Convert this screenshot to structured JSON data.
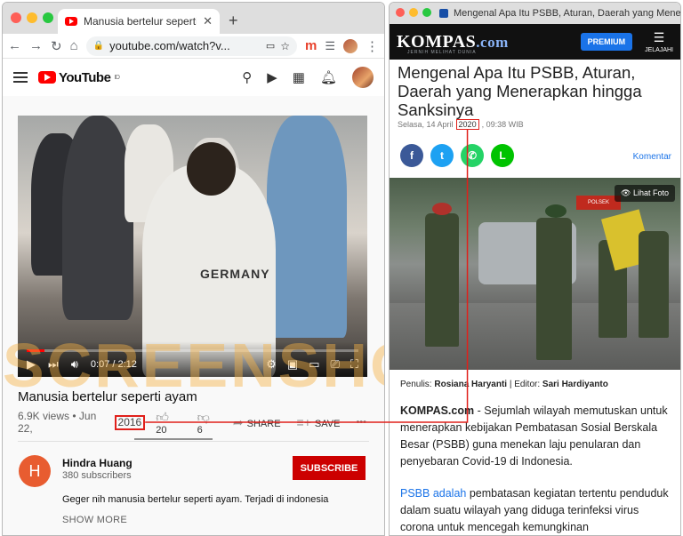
{
  "youtube_window": {
    "tab_title": "Manusia bertelur seperti ayam",
    "tab_close": "✕",
    "new_tab": "+",
    "url": "youtube.com/watch?v...",
    "logo": "YouTube",
    "logo_region": "ID",
    "player": {
      "time": "0:07 / 2:12",
      "progress": 0.053
    },
    "video_title": "Manusia bertelur seperti ayam",
    "views_date": "6.9K views • Jun 22,",
    "year_highlight": "2016",
    "likes": "20",
    "dislikes": "6",
    "share_label": "SHARE",
    "save_label": "SAVE",
    "more": "•••",
    "channel_initial": "H",
    "channel_name": "Hindra Huang",
    "subscribers": "380 subscribers",
    "subscribe_label": "SUBSCRIBE",
    "description": "Geger nih manusia bertelur seperti ayam. Terjadi di indonesia",
    "show_more": "SHOW MORE"
  },
  "watermark": "SCREENSHOT",
  "kompas_window": {
    "tab_title": "Mengenal Apa Itu PSBB, Aturan, Daerah yang Menerap...",
    "logo": "KOMPAS",
    "logo_suffix": ".com",
    "tagline": "JERNIH MELIHAT DUNIA",
    "premium_label": "PREMIUM",
    "jelajahi_label": "JELAJAHI",
    "headline": "Mengenal Apa Itu PSBB, Aturan, Daerah yang Menerapkan hingga Sanksinya",
    "date_prefix": "Selasa, 14 April",
    "year_highlight": "2020",
    "date_suffix": ", 09:38 WIB",
    "komentar_label": "Komentar",
    "lihat_foto": "Lihat Foto",
    "penulis_label": "Penulis:",
    "penulis_name": "Rosiana Haryanti",
    "editor_label": "| Editor:",
    "editor_name": "Sari Hardiyanto",
    "para1_lead": "KOMPAS.com",
    "para1_text": " - Sejumlah wilayah memutuskan untuk menerapkan kebijakan Pembatasan Sosial Berskala Besar (PSBB) guna menekan laju penularan dan penyebaran Covid-19 di Indonesia.",
    "para2_link": "PSBB adalah",
    "para2_text": " pembatasan kegiatan tertentu penduduk dalam suatu wilayah yang diduga terinfeksi virus corona untuk mencegah kemungkinan"
  },
  "colors": {
    "highlight": "#e0201b",
    "youtube_red": "#ff0000",
    "kompas_blue": "#1a73e8"
  }
}
